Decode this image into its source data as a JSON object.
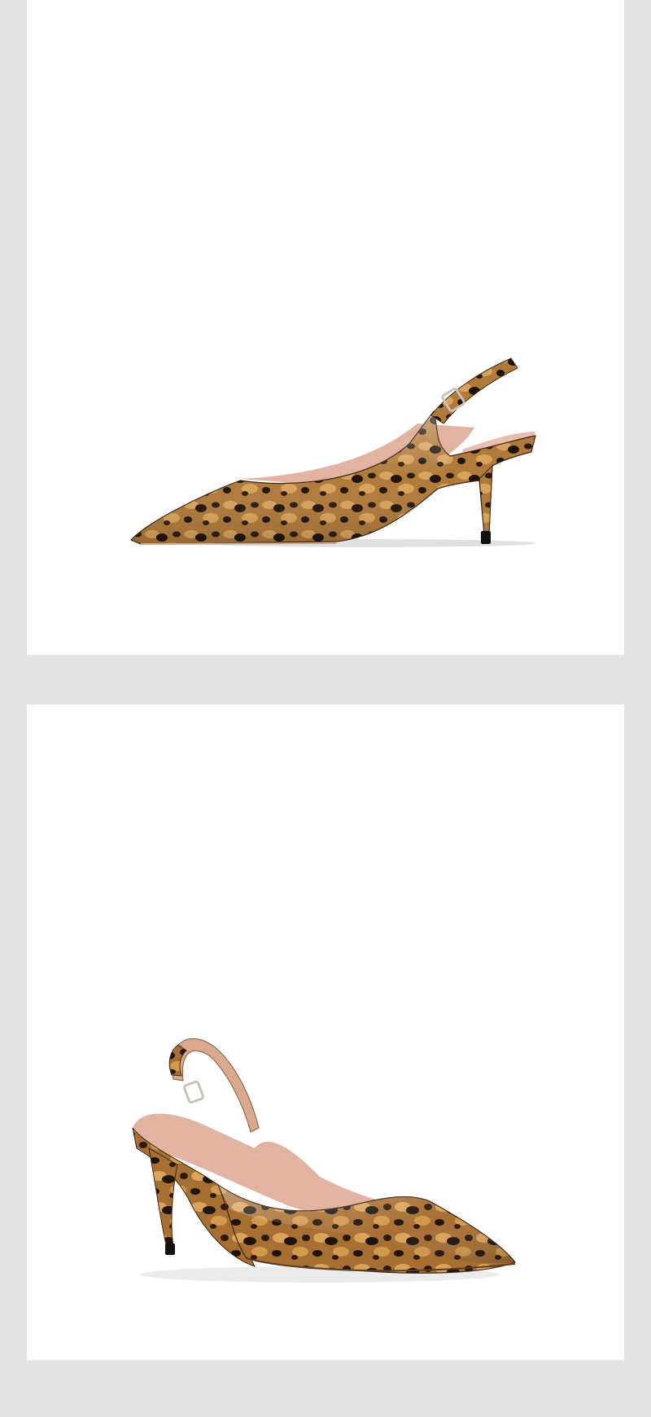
{
  "page": {
    "background_color": "#e4e4e4",
    "panel_color": "#ffffff"
  },
  "products": [
    {
      "view": "side-profile",
      "subject": "leopard-print-patent-slingback-pump"
    },
    {
      "view": "three-quarter",
      "subject": "leopard-print-patent-slingback-pump"
    }
  ],
  "colors": {
    "leopard_base": "#b07a3a",
    "leopard_light": "#d9a45a",
    "leopard_spot": "#1e140c",
    "lining": "#e2b3a0",
    "buckle": "#c9c2b6"
  }
}
